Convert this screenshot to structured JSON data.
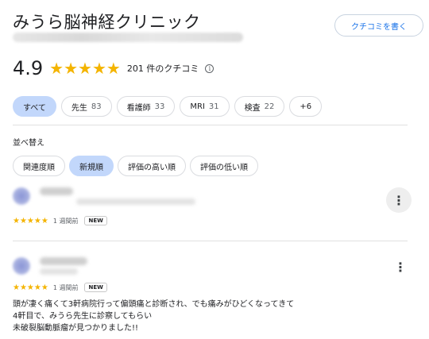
{
  "header": {
    "title": "みうら脳神経クリニック",
    "write_review_label": "クチコミを書く"
  },
  "rating": {
    "score": "4.9",
    "stars": "★★★★★",
    "count_text": "201 件のクチコミ",
    "info_glyph": "i"
  },
  "filters": [
    {
      "label": "すべて",
      "count": ""
    },
    {
      "label": "先生",
      "count": "83"
    },
    {
      "label": "看護師",
      "count": "33"
    },
    {
      "label": "MRI",
      "count": "31"
    },
    {
      "label": "検査",
      "count": "22"
    },
    {
      "label": "+6",
      "count": ""
    }
  ],
  "sort": {
    "label": "並べ替え",
    "options": [
      "関連度順",
      "新規順",
      "評価の高い順",
      "評価の低い順"
    ]
  },
  "reviews": [
    {
      "stars": "★★★★★",
      "ago": "1 週間前",
      "badge": "NEW",
      "more_glyph": "⋮",
      "text": ""
    },
    {
      "stars": "★★★★★",
      "ago": "1 週間前",
      "badge": "NEW",
      "more_glyph": "⋮",
      "text_lines": [
        "頭が凄く痛くて3軒病院行って偏頭痛と診断され、でも痛みがひどくなってきて",
        "4軒目で、みうら先生に診察してもらい",
        "未破裂脳動脈瘤が見つかりました!!"
      ]
    }
  ],
  "colors": {
    "star": "#f4b400",
    "active_chip": "#c2d7fb",
    "link_blue": "#1a73e8"
  }
}
